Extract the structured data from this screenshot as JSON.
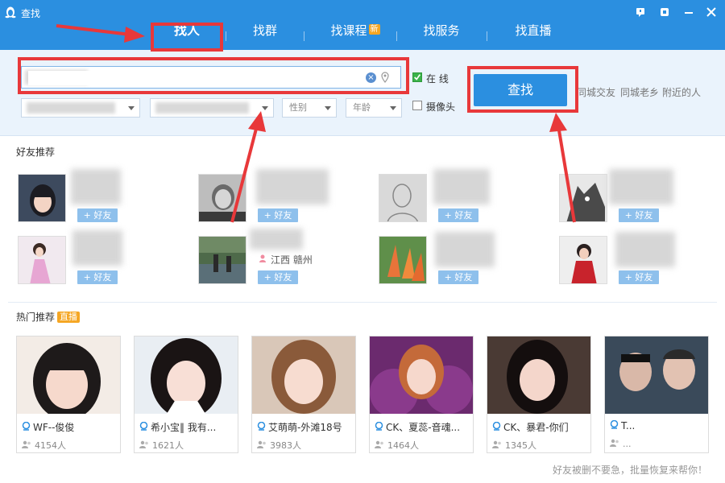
{
  "window": {
    "title": "查找",
    "controls": [
      "feedback-icon",
      "skin-icon",
      "minimize-icon",
      "close-icon"
    ]
  },
  "tabs": [
    {
      "label": "找人",
      "active": true
    },
    {
      "label": "找群",
      "active": false
    },
    {
      "label": "找课程",
      "active": false,
      "badge": "新"
    },
    {
      "label": "找服务",
      "active": false
    },
    {
      "label": "找直播",
      "active": false
    }
  ],
  "search": {
    "placeholder": "",
    "online_label": "在  线",
    "online_checked": true,
    "camera_label": "摄像头",
    "camera_checked": false,
    "gender_select": "性别",
    "age_select": "年龄",
    "button": "查找",
    "quick_links": [
      "同城交友",
      "同城老乡",
      "附近的人"
    ]
  },
  "friends": {
    "title": "好友推荐",
    "add_label": "+ 好友",
    "items": [
      {
        "location": ""
      },
      {
        "location": ""
      },
      {
        "location": ""
      },
      {
        "location": ""
      },
      {
        "location": ""
      },
      {
        "location": "江西  赣州"
      },
      {
        "location": ""
      },
      {
        "location": ""
      }
    ]
  },
  "live": {
    "title": "热门推荐",
    "badge": "直播",
    "items": [
      {
        "name": "WF--俊俊",
        "viewers": "4154人"
      },
      {
        "name": "希小宝‖ 我有...",
        "viewers": "1621人"
      },
      {
        "name": "艾萌萌-外滩18号",
        "viewers": "3983人"
      },
      {
        "name": "CK、夏蕊-音魂...",
        "viewers": "1464人"
      },
      {
        "name": "CK、暴君-你们",
        "viewers": "1345人"
      },
      {
        "name": "T...",
        "viewers": "..."
      }
    ]
  },
  "footer": {
    "note": "好友被删不要急，批量恢复来帮你！"
  },
  "colors": {
    "brand": "#2b8fe0",
    "highlight": "#e8383a",
    "badge": "#f5a623"
  }
}
